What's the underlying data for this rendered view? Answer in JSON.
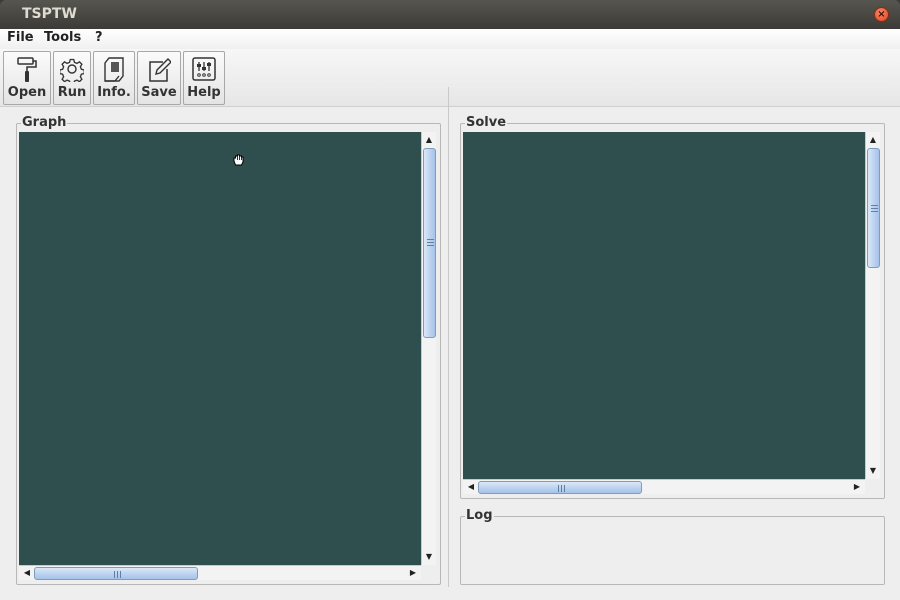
{
  "window": {
    "title": "TSPTW",
    "close_symbol": "×"
  },
  "menu": {
    "items": [
      {
        "label": "File"
      },
      {
        "label": "Tools"
      },
      {
        "label": "?"
      }
    ]
  },
  "toolbar": {
    "buttons": [
      {
        "label": "Open",
        "icon": "paint-roller-icon"
      },
      {
        "label": "Run",
        "icon": "gear-icon"
      },
      {
        "label": "Info.",
        "icon": "scroll-document-icon"
      },
      {
        "label": "Save",
        "icon": "edit-note-icon"
      },
      {
        "label": "Help",
        "icon": "sliders-icon"
      }
    ]
  },
  "panels": {
    "graph": {
      "title": "Graph",
      "canvas_color": "#2f4f4f"
    },
    "solve": {
      "title": "Solve",
      "canvas_color": "#2f4f4f"
    },
    "log": {
      "title": "Log",
      "content": ""
    }
  },
  "scroll": {
    "up": "▲",
    "down": "▼",
    "left": "◀",
    "right": "▶"
  }
}
